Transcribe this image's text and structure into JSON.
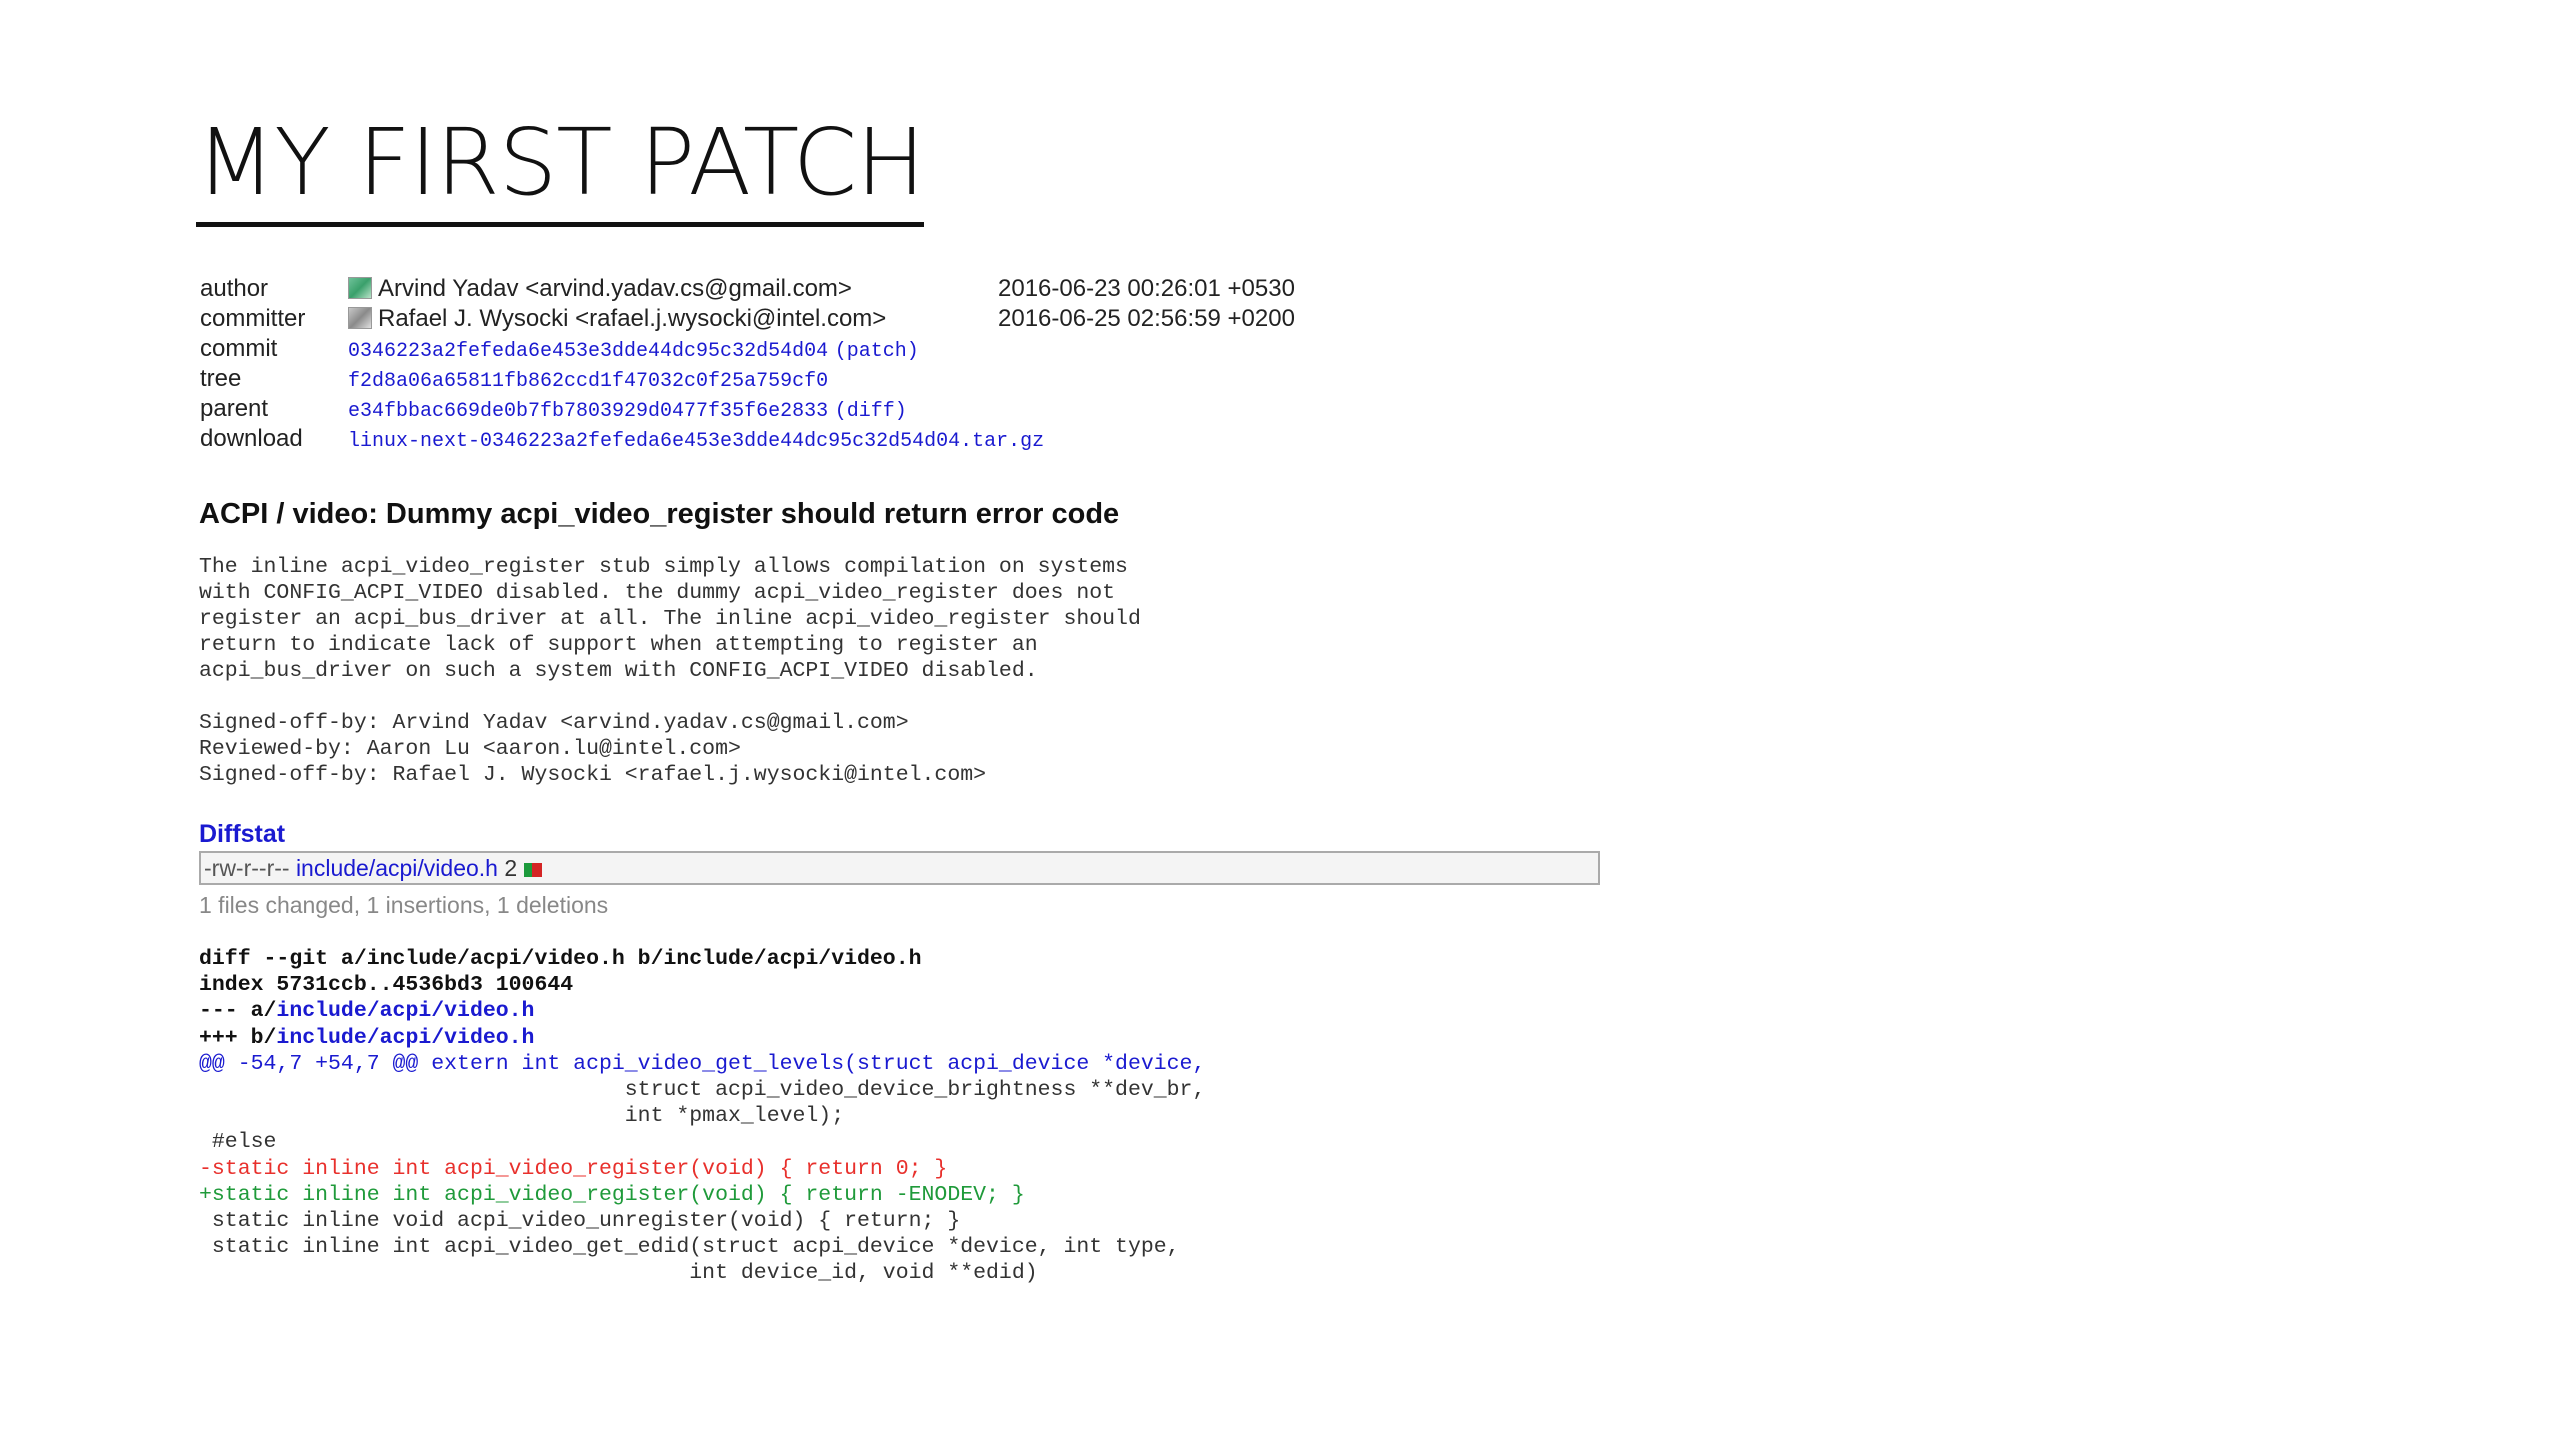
{
  "slide": {
    "title": "MY FIRST PATCH"
  },
  "meta": {
    "author": {
      "label": "author",
      "name": "Arvind Yadav <arvind.yadav.cs@gmail.com>",
      "date": "2016-06-23 00:26:01 +0530"
    },
    "committer": {
      "label": "committer",
      "name": "Rafael J. Wysocki <rafael.j.wysocki@intel.com>",
      "date": "2016-06-25 02:56:59 +0200"
    },
    "commit": {
      "label": "commit",
      "hash": "0346223a2fefeda6e453e3dde44dc95c32d54d04",
      "link": "(patch)"
    },
    "tree": {
      "label": "tree",
      "hash": "f2d8a06a65811fb862ccd1f47032c0f25a759cf0"
    },
    "parent": {
      "label": "parent",
      "hash": "e34fbbac669de0b7fb7803929d0477f35f6e2833",
      "link": "(diff)"
    },
    "download": {
      "label": "download",
      "file": "linux-next-0346223a2fefeda6e453e3dde44dc95c32d54d04.tar.gz"
    }
  },
  "commit_subject": "ACPI / video: Dummy acpi_video_register should return error code",
  "commit_message": [
    "The inline acpi_video_register stub simply allows compilation on systems",
    "with CONFIG_ACPI_VIDEO disabled. the dummy acpi_video_register does not",
    "register an acpi_bus_driver at all. The inline acpi_video_register should",
    "return to indicate lack of support when attempting to register an",
    "acpi_bus_driver on such a system with CONFIG_ACPI_VIDEO disabled.",
    "",
    "Signed-off-by: Arvind Yadav <arvind.yadav.cs@gmail.com>",
    "Reviewed-by: Aaron Lu <aaron.lu@intel.com>",
    "Signed-off-by: Rafael J. Wysocki <rafael.j.wysocki@intel.com>"
  ],
  "diffstat": {
    "header": "Diffstat",
    "mode": "-rw-r--r--",
    "file": "include/acpi/video.h",
    "count": "2",
    "summary": "1 files changed, 1 insertions, 1 deletions"
  },
  "diff": {
    "git_line": "diff --git a/include/acpi/video.h b/include/acpi/video.h",
    "index_line": "index 5731ccb..4536bd3 100644",
    "minus_prefix": "--- a/",
    "plus_prefix": "+++ b/",
    "file_path": "include/acpi/video.h",
    "hunk": "@@ -54,7 +54,7 @@ extern int acpi_video_get_levels(struct acpi_device *device,",
    "lines": [
      {
        "type": "ctx",
        "text": "                                 struct acpi_video_device_brightness **dev_br,"
      },
      {
        "type": "ctx",
        "text": "                                 int *pmax_level);"
      },
      {
        "type": "ctx",
        "text": " #else"
      },
      {
        "type": "del",
        "text": "-static inline int acpi_video_register(void) { return 0; }"
      },
      {
        "type": "add",
        "text": "+static inline int acpi_video_register(void) { return -ENODEV; }"
      },
      {
        "type": "ctx",
        "text": " static inline void acpi_video_unregister(void) { return; }"
      },
      {
        "type": "ctx",
        "text": " static inline int acpi_video_get_edid(struct acpi_device *device, int type,"
      },
      {
        "type": "ctx",
        "text": "                                      int device_id, void **edid)"
      }
    ]
  }
}
